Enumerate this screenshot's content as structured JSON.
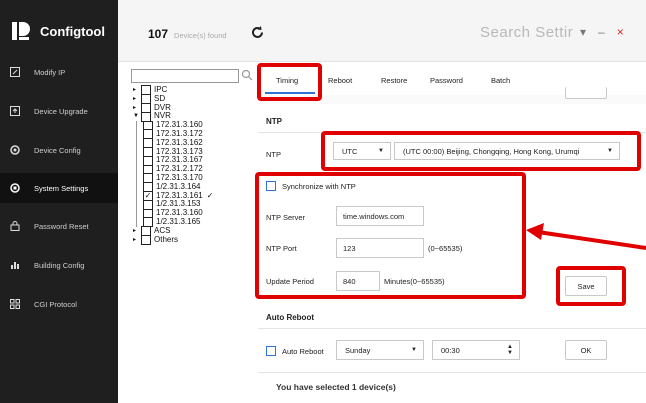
{
  "app": {
    "title": "Configtool"
  },
  "sidebar": {
    "items": [
      {
        "label": "Modify IP",
        "icon": "edit-box-icon"
      },
      {
        "label": "Device Upgrade",
        "icon": "upload-box-icon"
      },
      {
        "label": "Device Config",
        "icon": "gear-icon"
      },
      {
        "label": "System Settings",
        "icon": "settings-circle-icon",
        "active": true
      },
      {
        "label": "Password Reset",
        "icon": "lock-icon"
      },
      {
        "label": "Building Config",
        "icon": "building-chart-icon"
      },
      {
        "label": "CGI Protocol",
        "icon": "grid-icon"
      }
    ]
  },
  "header": {
    "device_count": "107",
    "device_count_label": "Device(s) found",
    "search_text": "Search Settir"
  },
  "tree": {
    "groups": [
      "IPC",
      "SD",
      "DVR",
      "NVR"
    ],
    "nvr_devices": [
      "172.31.3.160",
      "172.31.3.172",
      "172.31.3.162",
      "172.31.3.173",
      "172.31.3.167",
      "172.31.2.172",
      "172.31.3.170",
      "1/2.31.3.164",
      "172.31.3.161",
      "1/2.31.3.153",
      "172.31.3.160",
      "1/2.31.3.165"
    ],
    "checked_device": "172.31.3.161",
    "other_groups": [
      "ACS",
      "Others"
    ]
  },
  "tabs": [
    "Timing",
    "Reboot",
    "Restore",
    "Password",
    "Batch"
  ],
  "ntp": {
    "section_title": "NTP",
    "ntp_label": "NTP",
    "ntp_type": "UTC",
    "timezone": "(UTC 00:00) Beijing, Chongqing, Hong Kong, Urumqi",
    "sync_label": "Synchronize with NTP",
    "server_label": "NTP Server",
    "server_value": "time.windows.com",
    "port_label": "NTP Port",
    "port_value": "123",
    "port_hint": "(0~65535)",
    "period_label": "Update Period",
    "period_value": "840",
    "period_hint": "Minutes(0~65535)",
    "save_label": "Save"
  },
  "auto_reboot": {
    "section_title": "Auto Reboot",
    "checkbox_label": "Auto Reboot",
    "day": "Sunday",
    "time": "00:30",
    "ok_label": "OK"
  },
  "footer": {
    "selected_text": "You have selected 1 device(s)"
  },
  "colors": {
    "sidebar": "#1f1f1f",
    "accent": "#2e75d6",
    "highlight": "#e00000"
  }
}
